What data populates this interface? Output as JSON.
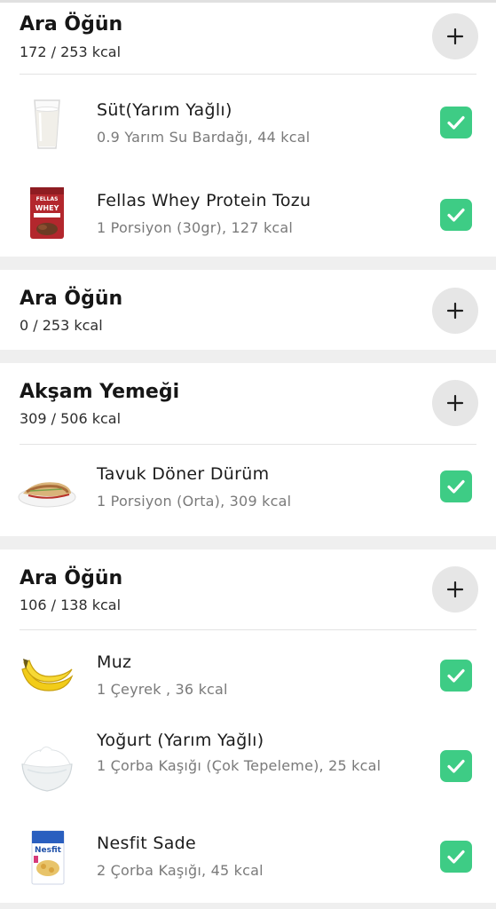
{
  "meals": [
    {
      "title": "Ara Öğün",
      "kcal": "172 / 253 kcal",
      "foods": [
        {
          "name": "Süt(Yarım Yağlı)",
          "detail": "0.9 Yarım Su Bardağı, 44 kcal",
          "thumb": "milk-glass-icon",
          "checked": true
        },
        {
          "name": "Fellas Whey Protein Tozu",
          "detail": "1 Porsiyon (30gr), 127 kcal",
          "thumb": "protein-pack-icon",
          "checked": true
        }
      ]
    },
    {
      "title": "Ara Öğün",
      "kcal": "0 / 253 kcal",
      "foods": []
    },
    {
      "title": "Akşam Yemeği",
      "kcal": "309 / 506 kcal",
      "foods": [
        {
          "name": "Tavuk Döner Dürüm",
          "detail": "1 Porsiyon (Orta), 309 kcal",
          "thumb": "doner-wrap-icon",
          "checked": true
        }
      ]
    },
    {
      "title": "Ara Öğün",
      "kcal": "106 / 138 kcal",
      "foods": [
        {
          "name": "Muz",
          "detail": "1 Çeyrek , 36 kcal",
          "thumb": "banana-icon",
          "checked": true
        },
        {
          "name": "Yoğurt (Yarım Yağlı)",
          "detail": "1 Çorba Kaşığı (Çok Tepeleme), 25 kcal",
          "thumb": "yogurt-bowl-icon",
          "checked": true
        },
        {
          "name": "Nesfit Sade",
          "detail": "2 Çorba Kaşığı, 45 kcal",
          "thumb": "cereal-box-icon",
          "checked": true
        }
      ]
    }
  ],
  "icons": {
    "add": "plus-icon",
    "checked": "checkmark-icon"
  },
  "colors": {
    "check_green": "#3ecc85",
    "add_button_bg": "#e6e6e6",
    "section_gap": "#efefef"
  },
  "plus_glyph": "+"
}
